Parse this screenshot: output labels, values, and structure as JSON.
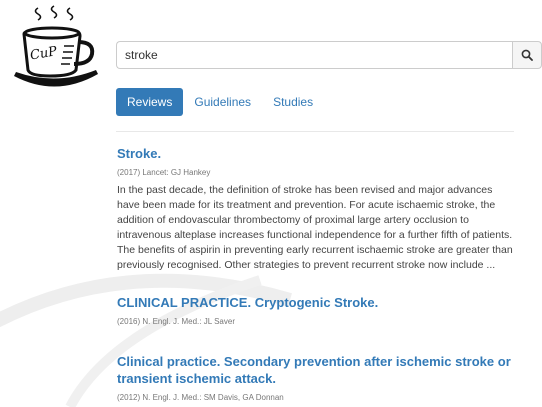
{
  "logo": {
    "text": "CuP",
    "icon": "coffee-cup-icon"
  },
  "search": {
    "value": "stroke",
    "button_icon": "search-icon"
  },
  "tabs": [
    {
      "label": "Reviews",
      "active": true
    },
    {
      "label": "Guidelines",
      "active": false
    },
    {
      "label": "Studies",
      "active": false
    }
  ],
  "results": [
    {
      "title": "Stroke.",
      "meta": "(2017) Lancet: GJ Hankey",
      "abstract": "In the past decade, the definition of stroke has been revised and major advances have been made for its treatment and prevention. For acute ischaemic stroke, the addition of endovascular thrombectomy of proximal large artery occlusion to intravenous alteplase increases functional independence for a further fifth of patients. The benefits of aspirin in preventing early recurrent ischaemic stroke are greater than previously recognised. Other strategies to prevent recurrent stroke now include ..."
    },
    {
      "title": "CLINICAL PRACTICE. Cryptogenic Stroke.",
      "meta": "(2016) N. Engl. J. Med.: JL Saver",
      "abstract": ""
    },
    {
      "title": "Clinical practice. Secondary prevention after ischemic stroke or transient ischemic attack.",
      "meta": "(2012) N. Engl. J. Med.: SM Davis, GA Donnan",
      "abstract": ""
    }
  ],
  "colors": {
    "accent": "#337ab7",
    "text": "#444444",
    "meta": "#777777"
  }
}
